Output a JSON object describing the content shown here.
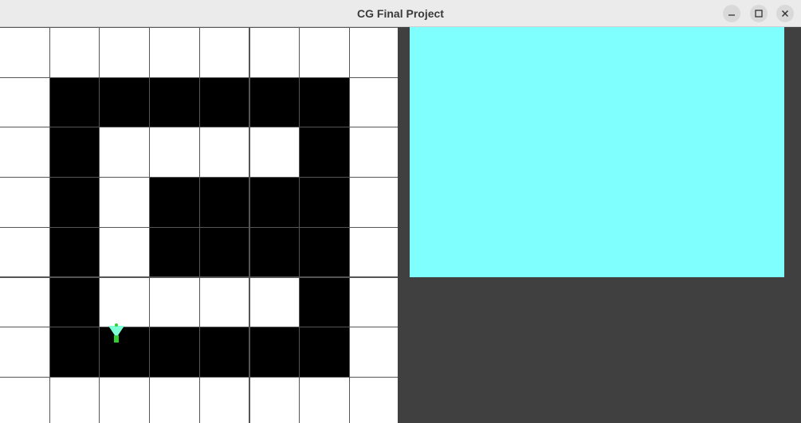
{
  "window": {
    "title": "CG Final Project",
    "controls": [
      "minimize-icon",
      "maximize-icon",
      "close-icon"
    ]
  },
  "colors": {
    "wall": "#000000",
    "floor": "#ffffff",
    "grid_line": "#555555",
    "view_background": "#80ffff",
    "panel_background": "#404040",
    "agent_body": "#7fffd4",
    "agent_marker": "#33cc33"
  },
  "maze": {
    "rows": 8,
    "cols": 8,
    "cells": [
      "wwwwwwww",
      "wbbbbbbw",
      "wbwwwwbw",
      "wbwbbbbw",
      "wbwbbbbw",
      "wbwwwwbw",
      "wbbbbbbw",
      "wwwwwwww"
    ],
    "agent_cell": {
      "row": 6,
      "col": 2
    }
  },
  "view_panel": {
    "name": "first-person-view"
  }
}
